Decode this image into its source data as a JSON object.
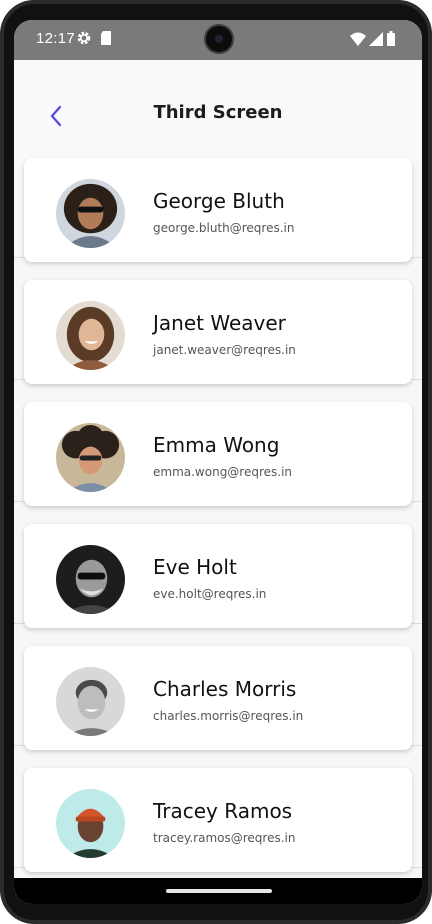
{
  "status": {
    "time": "12:17"
  },
  "header": {
    "title": "Third Screen"
  },
  "users": [
    {
      "name": "George Bluth",
      "email": "george.bluth@reqres.in"
    },
    {
      "name": "Janet Weaver",
      "email": "janet.weaver@reqres.in"
    },
    {
      "name": "Emma Wong",
      "email": "emma.wong@reqres.in"
    },
    {
      "name": "Eve Holt",
      "email": "eve.holt@reqres.in"
    },
    {
      "name": "Charles Morris",
      "email": "charles.morris@reqres.in"
    },
    {
      "name": "Tracey Ramos",
      "email": "tracey.ramos@reqres.in"
    }
  ],
  "colors": {
    "accent": "#4f46e5",
    "card": "#ffffff",
    "background": "#f7f7f9"
  }
}
